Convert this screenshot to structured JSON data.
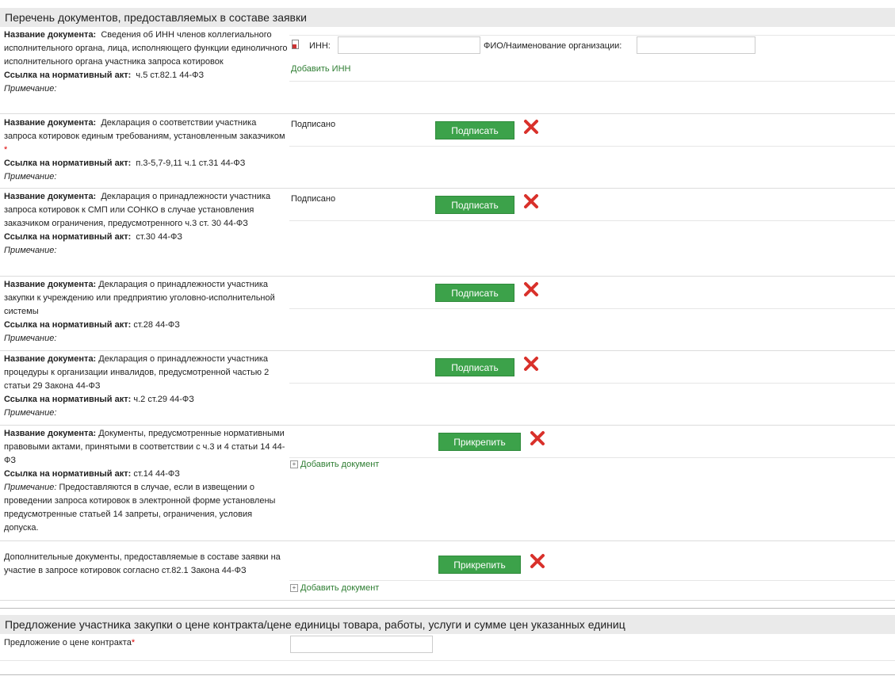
{
  "section1": {
    "title": "Перечень документов, предоставляемых в составе заявки"
  },
  "labels": {
    "doc_name": "Название документа:",
    "norm_ref": "Ссылка на нормативный акт:",
    "note": "Примечание:",
    "required_mark": "*"
  },
  "inn_row": {
    "inn_label": "ИНН:",
    "inn_value": "",
    "fio_label": "ФИО/Наименование организации:",
    "fio_value": "",
    "add_inn": "Добавить ИНН"
  },
  "documents": [
    {
      "name": "Сведения об ИНН членов коллегиального исполнительного органа, лица, исполняющего функции единоличного исполнительного органа участника запроса котировок",
      "ref": "ч.5 ст.82.1 44-ФЗ",
      "note": ""
    },
    {
      "name": "Декларация о соответствии участника запроса котировок единым требованиям, установленным заказчиком",
      "ref": "п.3-5,7-9,11 ч.1 ст.31 44-ФЗ",
      "note": "",
      "status": "Подписано",
      "button": "Подписать"
    },
    {
      "name": "Декларация о принадлежности участника запроса котировок к СМП или СОНКО в случае установления заказчиком ограничения, предусмотренного ч.3 ст. 30 44-ФЗ",
      "ref": "ст.30 44-ФЗ",
      "note": "",
      "status": "Подписано",
      "button": "Подписать"
    },
    {
      "name": "Декларация о принадлежности участника закупки к учреждению или предприятию уголовно-исполнительной системы",
      "ref": "ст.28 44-ФЗ",
      "note": "",
      "button": "Подписать"
    },
    {
      "name": "Декларация о принадлежности участника процедуры к организации инвалидов, предусмотренной частью 2 статьи 29 Закона 44-ФЗ",
      "ref": "ч.2 ст.29 44-ФЗ",
      "note": "",
      "button": "Подписать"
    },
    {
      "name": "Документы, предусмотренные нормативными правовыми актами, принятыми в соответствии с ч.3 и 4 статьи 14 44-ФЗ",
      "ref": "ст.14 44-ФЗ",
      "note": "Предоставляются в случае, если в извещении о проведении запроса котировок в электронной форме установлены предусмотренные статьей 14 запреты, ограничения, условия допуска.",
      "button": "Прикрепить",
      "add_doc": "Добавить документ"
    }
  ],
  "additional": {
    "text": "Дополнительные документы, предоставляемые в составе заявки на участие в запросе котировок согласно ст.82.1 Закона 44-ФЗ",
    "button": "Прикрепить",
    "add_doc": "Добавить документ"
  },
  "section2": {
    "title": "Предложение участника закупки о цене контракта/цене единицы товара, работы, услуги и сумме цен указанных единиц",
    "price_label": "Предложение о цене контракта",
    "price_value": ""
  },
  "colors": {
    "button_green": "#3ca24a",
    "delete_red": "#d9312b",
    "link_green": "#2e7d32",
    "header_bg": "#eaeaea"
  }
}
